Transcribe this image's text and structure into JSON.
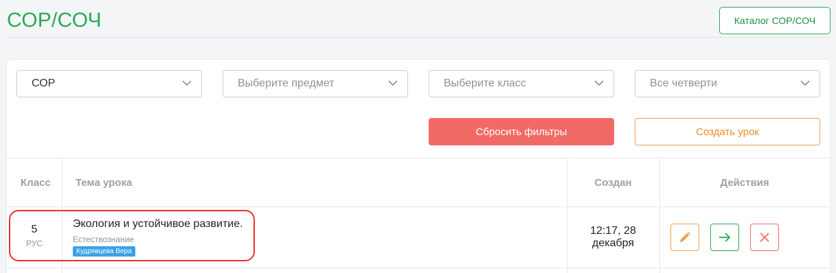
{
  "header": {
    "title": "СОР/СОЧ",
    "catalog_button": "Каталог СОР/СОЧ"
  },
  "filters": {
    "type": {
      "value": "СОР",
      "is_placeholder": false
    },
    "subject": {
      "value": "Выберите предмет",
      "is_placeholder": true
    },
    "grade": {
      "value": "Выберите класс",
      "is_placeholder": true
    },
    "quarter": {
      "value": "Все четверти",
      "is_placeholder": true
    }
  },
  "buttons": {
    "reset": "Сбросить фильтры",
    "create": "Создать урок"
  },
  "table": {
    "columns": {
      "grade": "Класс",
      "topic": "Тема урока",
      "created": "Создан",
      "actions": "Действия"
    },
    "rows": [
      {
        "grade": "5",
        "language": "РУС",
        "topic": "Экология и устойчивое развитие.",
        "subject": "Естествознание",
        "author": "Кудрявцева Вера",
        "created_line1": "12:17, 28",
        "created_line2": "декабря"
      }
    ]
  },
  "colors": {
    "accent_green": "#2aa955",
    "reset_red": "#f26a66",
    "create_orange": "#f0a04b",
    "badge_blue": "#3ba2e4",
    "highlight_red": "#e8332a"
  },
  "icons": {
    "edit": "pencil-icon",
    "open": "arrow-right-icon",
    "delete": "close-icon",
    "dropdown": "chevron-down-icon"
  }
}
